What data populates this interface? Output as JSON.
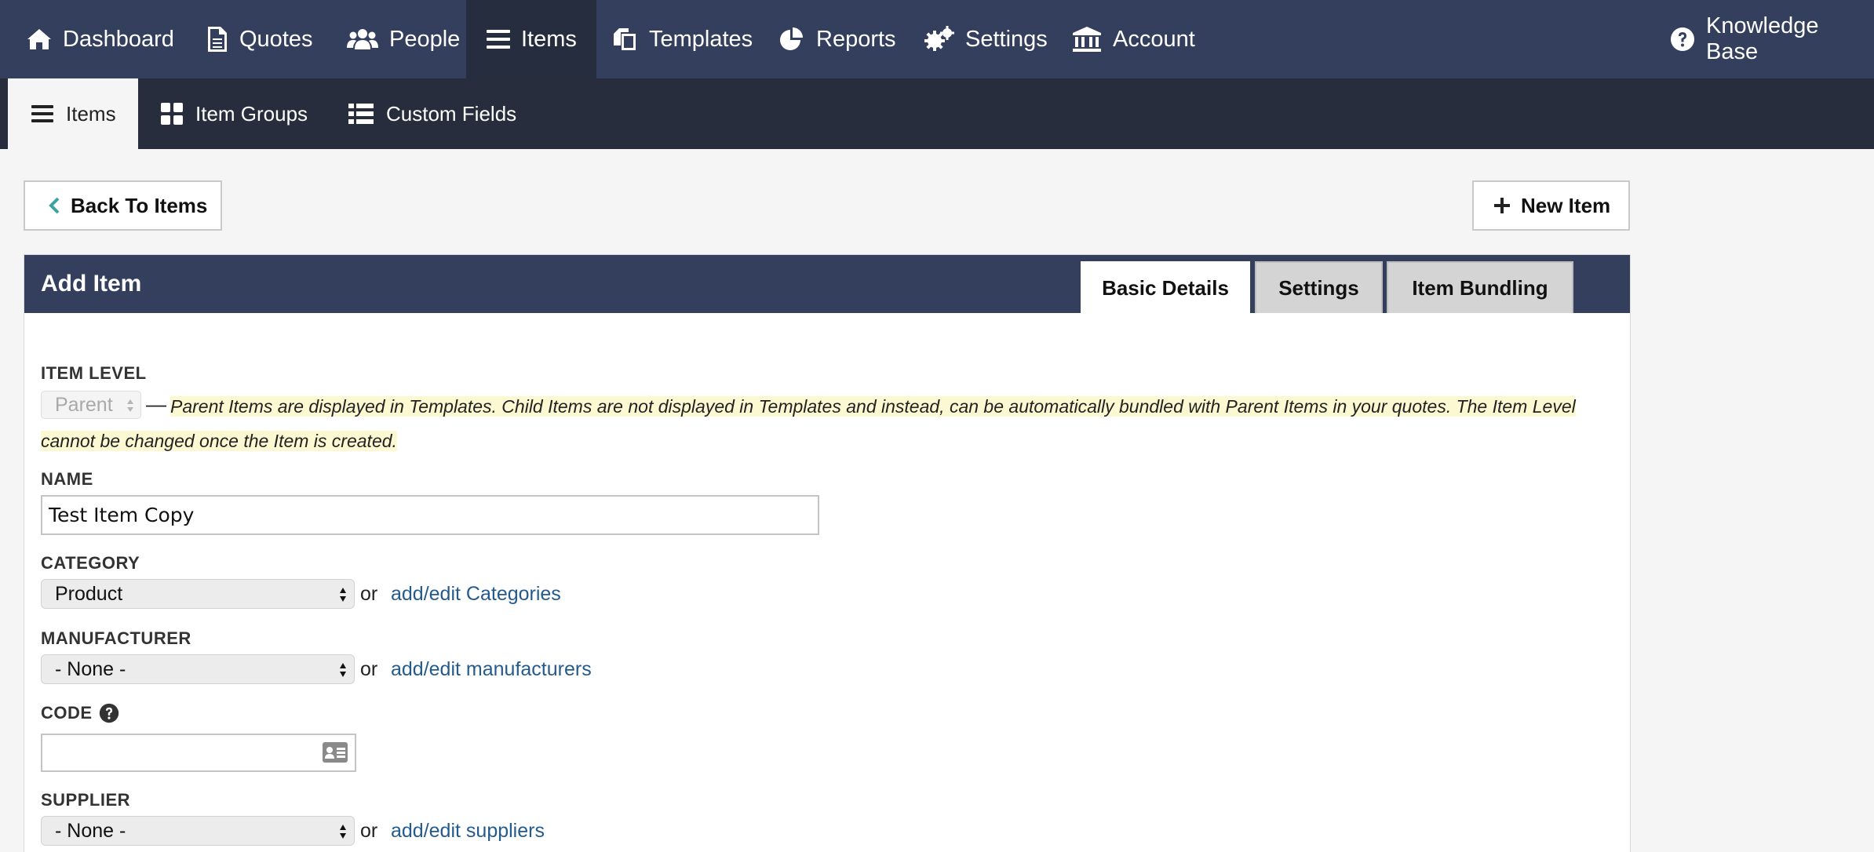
{
  "topnav": {
    "items": [
      {
        "label": "Dashboard",
        "icon": "home-icon"
      },
      {
        "label": "Quotes",
        "icon": "document-icon"
      },
      {
        "label": "People",
        "icon": "users-icon"
      },
      {
        "label": "Items",
        "icon": "list-icon",
        "active": true
      },
      {
        "label": "Templates",
        "icon": "copy-icon"
      },
      {
        "label": "Reports",
        "icon": "pie-chart-icon"
      },
      {
        "label": "Settings",
        "icon": "gears-icon"
      },
      {
        "label": "Account",
        "icon": "bank-icon"
      }
    ],
    "help": {
      "label": "Knowledge Base",
      "icon": "question-circle-icon"
    }
  },
  "subnav": {
    "items": [
      {
        "label": "Items",
        "icon": "list-icon",
        "active": true
      },
      {
        "label": "Item Groups",
        "icon": "grid-icon"
      },
      {
        "label": "Custom Fields",
        "icon": "list-detail-icon"
      }
    ]
  },
  "actions": {
    "back_label": "Back To Items",
    "new_label": "New Item"
  },
  "panel": {
    "title": "Add Item",
    "tabs": [
      {
        "label": "Basic Details",
        "active": true
      },
      {
        "label": "Settings"
      },
      {
        "label": "Item Bundling"
      }
    ]
  },
  "form": {
    "item_level": {
      "label": "ITEM LEVEL",
      "value": "Parent",
      "dash": "—",
      "note": "Parent Items are displayed in Templates. Child Items are not displayed in Templates and instead, can be automatically bundled with Parent Items in your quotes. The Item Level cannot be changed once the Item is created."
    },
    "name": {
      "label": "NAME",
      "value": "Test Item Copy"
    },
    "category": {
      "label": "CATEGORY",
      "value": "Product",
      "or": "or",
      "link": "add/edit Categories"
    },
    "manufacturer": {
      "label": "MANUFACTURER",
      "value": "- None -",
      "or": "or",
      "link": "add/edit manufacturers"
    },
    "code": {
      "label": "CODE",
      "value": ""
    },
    "supplier": {
      "label": "SUPPLIER",
      "value": "- None -",
      "or": "or",
      "link": "add/edit suppliers"
    }
  },
  "colors": {
    "nav": "#343f5e",
    "subnav": "#272d3d",
    "link": "#245b8e",
    "highlight": "#fcf8d2"
  }
}
